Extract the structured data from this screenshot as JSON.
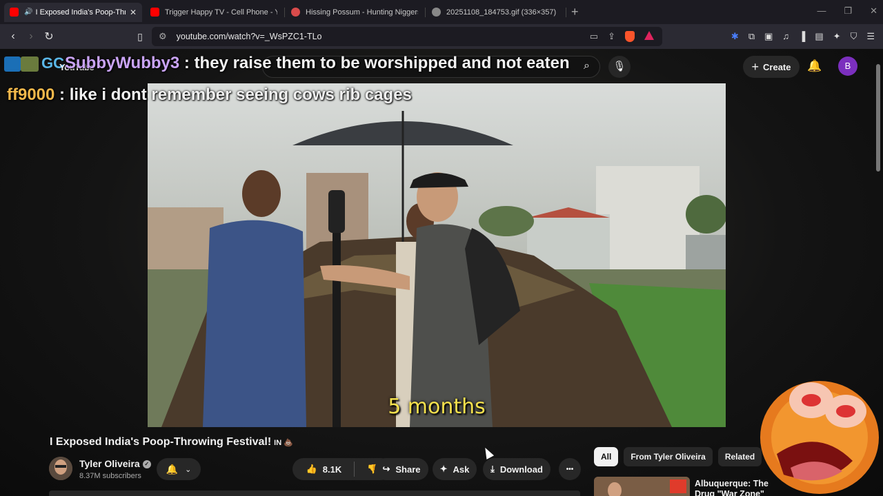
{
  "browser": {
    "tabs": [
      {
        "title": "I Exposed India's Poop-Throw",
        "favicon_color": "#ff0000",
        "active": true
      },
      {
        "title": "Trigger Happy TV - Cell Phone - YouT",
        "favicon_color": "#ff0000",
        "active": false
      },
      {
        "title": "Hissing Possum - Hunting Niggers in",
        "favicon_color": "#d94b4b",
        "active": false
      },
      {
        "title": "20251108_184753.gif (336×357)",
        "favicon_color": "#888888",
        "active": false
      }
    ],
    "url": "youtube.com/watch?v=_WsPZC1-TLo"
  },
  "youtube": {
    "logo_text": "YouTube",
    "create_label": "Create",
    "avatar_letter": "B"
  },
  "chat_overlay": [
    {
      "user": "SubbyWubby3",
      "message": " : they raise them to be worshipped and not eaten"
    },
    {
      "user": "ff9000",
      "message": " : like i dont remember seeing cows rib cages"
    }
  ],
  "video": {
    "caption": "5 months",
    "title": "I Exposed India's Poop-Throwing Festival!",
    "title_badge": "IN 💩"
  },
  "channel": {
    "name": "Tyler Oliveira",
    "subscribers": "8.37M subscribers"
  },
  "actions": {
    "like_count": "8.1K",
    "share_label": "Share",
    "ask_label": "Ask",
    "download_label": "Download",
    "more_label": "•••"
  },
  "related": {
    "chips": [
      "All",
      "From Tyler Oliveira",
      "Related"
    ],
    "first_video_title": "Albuquerque: The Drug \"War Zone\""
  },
  "colors": {
    "chat_user1": "#c9a3f5",
    "chat_user2": "#f2b84b",
    "caption": "#f4e04d",
    "avatar": "#7b2fbe"
  }
}
